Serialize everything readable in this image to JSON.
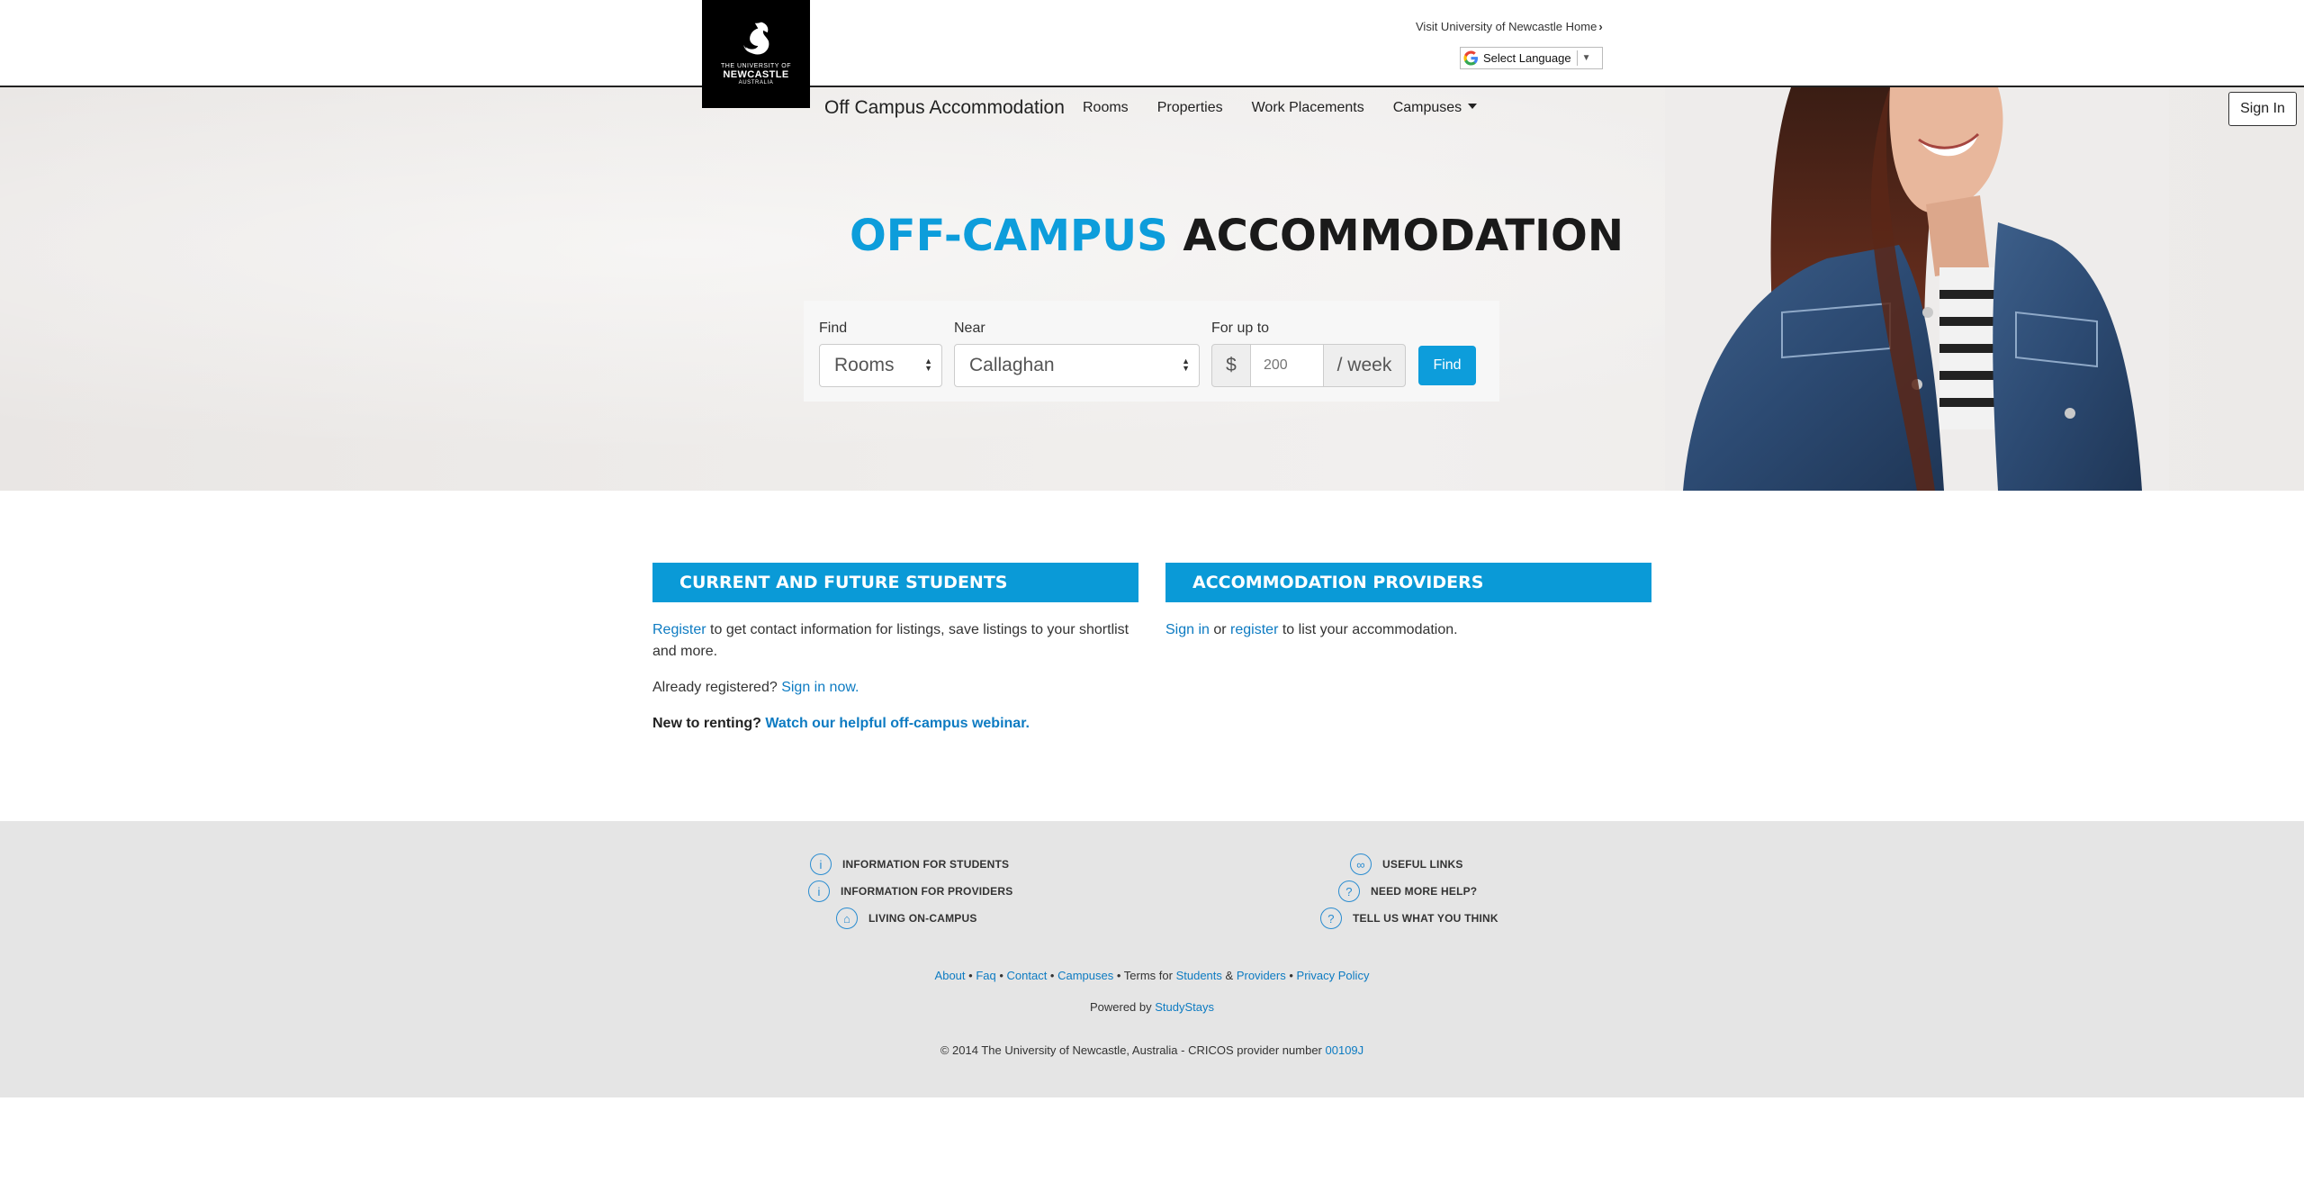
{
  "header": {
    "logo": {
      "line1": "THE UNIVERSITY OF",
      "line2": "NEWCASTLE",
      "line3": "AUSTRALIA"
    },
    "visit_link": "Visit University of Newcastle Home",
    "translate_label": "Select Language"
  },
  "nav": {
    "site_title": "Off Campus Accommodation",
    "items": [
      "Rooms",
      "Properties",
      "Work Placements",
      "Campuses"
    ],
    "signin": "Sign In"
  },
  "hero": {
    "title_blue": "OFF-CAMPUS",
    "title_dark": "ACCOMMODATION"
  },
  "search": {
    "find_label": "Find",
    "find_value": "Rooms",
    "near_label": "Near",
    "near_value": "Callaghan",
    "price_label": "For up to",
    "currency": "$",
    "price_placeholder": "200",
    "per": "/ week",
    "button": "Find"
  },
  "students": {
    "heading": "CURRENT AND FUTURE STUDENTS",
    "register_link": "Register",
    "register_text": " to get contact information for listings, save listings to your shortlist and more.",
    "already_text": "Already registered? ",
    "signin_link": "Sign in now.",
    "new_text": "New to renting? ",
    "webinar_link": "Watch our helpful off-campus webinar."
  },
  "providers": {
    "heading": "ACCOMMODATION PROVIDERS",
    "signin_link": "Sign in",
    "or_text": " or ",
    "register_link": "register",
    "rest_text": " to list your accommodation."
  },
  "footer": {
    "left_links": [
      "INFORMATION FOR STUDENTS",
      "INFORMATION FOR PROVIDERS",
      "LIVING ON-CAMPUS"
    ],
    "right_links": [
      "USEFUL LINKS",
      "NEED MORE HELP?",
      "TELL US WHAT YOU THINK"
    ],
    "bottom_links": {
      "about": "About",
      "faq": "Faq",
      "contact": "Contact",
      "campuses": "Campuses",
      "terms_for": "Terms for",
      "students": "Students",
      "amp": "&",
      "providers": "Providers",
      "privacy": "Privacy Policy"
    },
    "powered_by": "Powered by",
    "powered_link": "StudyStays",
    "copyright": "© 2014 The University of Newcastle, Australia - CRICOS provider number",
    "cricos": "00109J"
  },
  "colors": {
    "brand_blue": "#0d9ddb",
    "panel_blue": "#0a9ad7",
    "link_blue": "#0d7bc2",
    "footer_bg": "#e5e5e5"
  }
}
